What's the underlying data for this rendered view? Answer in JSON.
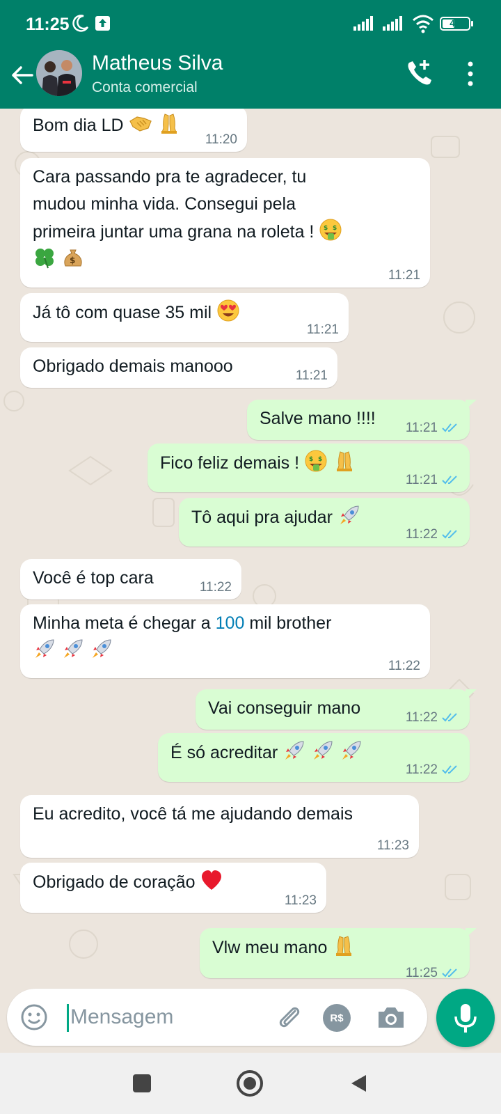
{
  "status_bar": {
    "time": "11:25",
    "battery": "44",
    "icons": [
      "moon-icon",
      "update-icon",
      "signal-icon",
      "signal-icon",
      "wifi-icon",
      "battery-icon"
    ]
  },
  "header": {
    "name": "Matheus Silva",
    "subtitle": "Conta comercial",
    "icons": [
      "back-arrow-icon",
      "add-call-icon",
      "more-vert-icon"
    ]
  },
  "messages": [
    {
      "dir": "in",
      "text": "Bom dia LD",
      "emojis": [
        "handshake",
        "pray"
      ],
      "time": "11:20"
    },
    {
      "dir": "in",
      "lines": [
        "Cara passando pra te agradecer, tu",
        "mudou minha vida. Consegui pela",
        "primeira juntar uma grana na roleta !"
      ],
      "emojis_line3": [
        "money-mouth"
      ],
      "emojis_line4": [
        "clover",
        "moneybag"
      ],
      "time": "11:21"
    },
    {
      "dir": "in",
      "text": "Já tô com quase 35 mil",
      "emojis": [
        "heart-eyes"
      ],
      "time": "11:21"
    },
    {
      "dir": "in",
      "text": "Obrigado demais manooo",
      "time": "11:21"
    },
    {
      "dir": "out",
      "text": "Salve mano !!!!",
      "time": "11:21",
      "read": true
    },
    {
      "dir": "out",
      "text": "Fico feliz demais !",
      "emojis": [
        "money-mouth",
        "pray"
      ],
      "time": "11:21",
      "read": true
    },
    {
      "dir": "out",
      "text": "Tô aqui pra ajudar",
      "emojis": [
        "rocket"
      ],
      "time": "11:22",
      "read": true
    },
    {
      "dir": "in",
      "text": "Você é top cara",
      "time": "11:22"
    },
    {
      "dir": "in",
      "text_before": "Minha meta é chegar a ",
      "link": "100",
      "text_after": " mil brother",
      "emojis_line2": [
        "rocket",
        "rocket",
        "rocket"
      ],
      "time": "11:22"
    },
    {
      "dir": "out",
      "text": "Vai conseguir mano",
      "time": "11:22",
      "read": true
    },
    {
      "dir": "out",
      "text": "É só acreditar",
      "emojis": [
        "rocket",
        "rocket",
        "rocket"
      ],
      "time": "11:22",
      "read": true
    },
    {
      "dir": "in",
      "text": "Eu acredito, você tá me ajudando demais",
      "time": "11:23"
    },
    {
      "dir": "in",
      "text": "Obrigado de coração",
      "emojis": [
        "heart"
      ],
      "time": "11:23"
    },
    {
      "dir": "out",
      "text": "Vlw meu mano",
      "emojis": [
        "pray"
      ],
      "time": "11:25",
      "read": true
    }
  ],
  "composer": {
    "placeholder": "Mensagem",
    "pay_label": "R$",
    "icons": [
      "emoji-icon",
      "attach-icon",
      "payment-icon",
      "camera-icon",
      "mic-icon"
    ]
  },
  "colors": {
    "header": "#008069",
    "incoming_bubble": "#ffffff",
    "outgoing_bubble": "#d9fdd3",
    "chat_bg": "#ece5dd",
    "read_ticks": "#53bdeb",
    "accent": "#00a884"
  }
}
